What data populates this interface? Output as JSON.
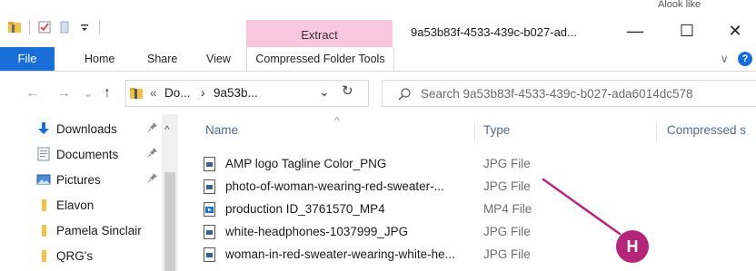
{
  "window": {
    "context_group": "Extract",
    "title": "9a53b83f-4533-439c-b027-ad...",
    "clipped_top_text": "Alook like",
    "controls": {
      "minimize": "—",
      "maximize": "☐",
      "close": "✕"
    }
  },
  "ribbon": {
    "file_tab": "File",
    "tabs": [
      "Home",
      "Share",
      "View"
    ],
    "context_tab": "Compressed Folder Tools",
    "expand_chevron": "∨",
    "help": "?"
  },
  "address": {
    "crumb_prefix": "«",
    "crumb_1": "Do...",
    "crumb_sep": "›",
    "crumb_2": "9a53b...",
    "dropdown": "⌄",
    "refresh": "↻",
    "search_placeholder": "Search 9a53b83f-4533-439c-b027-ada6014dc578"
  },
  "nav_buttons": {
    "back": "←",
    "forward": "→",
    "recent": "⌄",
    "up": "↑"
  },
  "nav_pane": {
    "items": [
      {
        "label": "Downloads",
        "icon": "download-icon",
        "pinned": true
      },
      {
        "label": "Documents",
        "icon": "documents-icon",
        "pinned": true
      },
      {
        "label": "Pictures",
        "icon": "pictures-icon",
        "pinned": true
      },
      {
        "label": "Elavon",
        "icon": "folder-icon",
        "pinned": false
      },
      {
        "label": "Pamela Sinclair",
        "icon": "folder-icon",
        "pinned": false
      },
      {
        "label": "QRG's",
        "icon": "folder-icon",
        "pinned": false
      }
    ],
    "pin_glyph": "📌",
    "scroll_up": "^"
  },
  "columns": {
    "name": "Name",
    "type": "Type",
    "compressed": "Compressed s",
    "sort_caret": "^"
  },
  "files": [
    {
      "name": "AMP logo Tagline Color_PNG",
      "type": "JPG File",
      "icon": "image-file-icon"
    },
    {
      "name": "photo-of-woman-wearing-red-sweater-...",
      "type": "JPG File",
      "icon": "image-file-icon"
    },
    {
      "name": "production ID_3761570_MP4",
      "type": "MP4 File",
      "icon": "video-file-icon"
    },
    {
      "name": "white-headphones-1037999_JPG",
      "type": "JPG File",
      "icon": "image-file-icon"
    },
    {
      "name": "woman-in-red-sweater-wearing-white-he...",
      "type": "JPG File",
      "icon": "image-file-icon"
    }
  ],
  "annotation": {
    "label": "H",
    "color": "#b5257a"
  },
  "colors": {
    "accent": "#1a6ed8",
    "context_tab": "#f9c6df",
    "folder": "#f0c24b"
  }
}
